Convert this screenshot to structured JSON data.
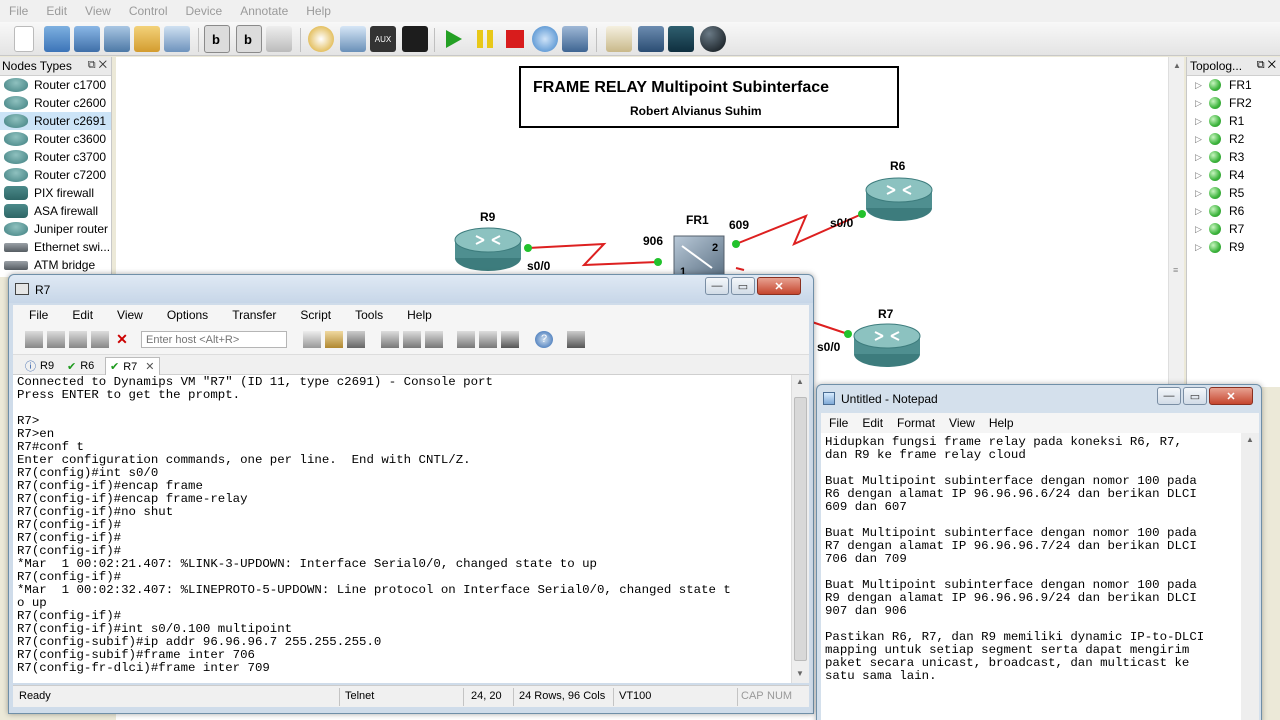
{
  "gns3": {
    "menu": [
      "File",
      "Edit",
      "View",
      "Control",
      "Device",
      "Annotate",
      "Help"
    ],
    "nodes_panel": {
      "title": "Nodes Types",
      "items": [
        {
          "label": "Router c1700",
          "icon": "router"
        },
        {
          "label": "Router c2600",
          "icon": "router"
        },
        {
          "label": "Router c2691",
          "icon": "router",
          "selected": true
        },
        {
          "label": "Router c3600",
          "icon": "router"
        },
        {
          "label": "Router c3700",
          "icon": "router"
        },
        {
          "label": "Router c7200",
          "icon": "router"
        },
        {
          "label": "PIX firewall",
          "icon": "firewall"
        },
        {
          "label": "ASA firewall",
          "icon": "firewall"
        },
        {
          "label": "Juniper router",
          "icon": "router"
        },
        {
          "label": "Ethernet swi...",
          "icon": "switch"
        },
        {
          "label": "ATM bridge",
          "icon": "switch"
        }
      ]
    },
    "topology_panel": {
      "title": "Topolog...",
      "items": [
        "FR1",
        "FR2",
        "R1",
        "R2",
        "R3",
        "R4",
        "R5",
        "R6",
        "R7",
        "R9"
      ]
    },
    "canvas": {
      "title_box": {
        "title": "FRAME RELAY Multipoint Subinterface",
        "author": "Robert Alvianus Suhim"
      },
      "devices": {
        "r9": "R9",
        "fr1": "FR1",
        "r6": "R6",
        "r7": "R7"
      },
      "labels": {
        "r9_port": "s0/0",
        "fr1_port_906": "906",
        "fr1_port_609": "609",
        "fr1_p2": "2",
        "fr1_p1": "1",
        "r6_port": "s0/0",
        "r7_port": "s0/0"
      },
      "link_color": "#dd2020",
      "port_color": "#22c22c"
    }
  },
  "securecrt": {
    "title": "R7",
    "menu": [
      "File",
      "Edit",
      "View",
      "Options",
      "Transfer",
      "Script",
      "Tools",
      "Help"
    ],
    "host_placeholder": "Enter host <Alt+R>",
    "tabs": [
      {
        "label": "R9",
        "status": "info-icon"
      },
      {
        "label": "R6",
        "status": "check-icon"
      },
      {
        "label": "R7",
        "status": "check-icon",
        "active": true
      }
    ],
    "terminal_lines": [
      "Connected to Dynamips VM \"R7\" (ID 11, type c2691) - Console port",
      "Press ENTER to get the prompt.",
      "",
      "R7>",
      "R7>en",
      "R7#conf t",
      "Enter configuration commands, one per line.  End with CNTL/Z.",
      "R7(config)#int s0/0",
      "R7(config-if)#encap frame",
      "R7(config-if)#encap frame-relay",
      "R7(config-if)#no shut",
      "R7(config-if)#",
      "R7(config-if)#",
      "R7(config-if)#",
      "*Mar  1 00:02:21.407: %LINK-3-UPDOWN: Interface Serial0/0, changed state to up",
      "R7(config-if)#",
      "*Mar  1 00:02:32.407: %LINEPROTO-5-UPDOWN: Line protocol on Interface Serial0/0, changed state t",
      "o up",
      "R7(config-if)#",
      "R7(config-if)#int s0/0.100 multipoint",
      "R7(config-subif)#ip addr 96.96.96.7 255.255.255.0",
      "R7(config-subif)#frame inter 706",
      "R7(config-fr-dlci)#frame inter 709"
    ],
    "status": {
      "state": "Ready",
      "protocol": "Telnet",
      "cursor": "24, 20",
      "size": "24 Rows, 96 Cols",
      "term": "VT100",
      "caps": "CAP",
      "num": "NUM"
    }
  },
  "notepad": {
    "title": "Untitled - Notepad",
    "menu": [
      "File",
      "Edit",
      "Format",
      "View",
      "Help"
    ],
    "text": "Hidupkan fungsi frame relay pada koneksi R6, R7,\ndan R9 ke frame relay cloud\n\nBuat Multipoint subinterface dengan nomor 100 pada\nR6 dengan alamat IP 96.96.96.6/24 dan berikan DLCI\n609 dan 607\n\nBuat Multipoint subinterface dengan nomor 100 pada\nR7 dengan alamat IP 96.96.96.7/24 dan berikan DLCI\n706 dan 709\n\nBuat Multipoint subinterface dengan nomor 100 pada\nR9 dengan alamat IP 96.96.96.9/24 dan berikan DLCI\n907 dan 906\n\nPastikan R6, R7, dan R9 memiliki dynamic IP-to-DLCI\nmapping untuk setiap segment serta dapat mengirim\npaket secara unicast, broadcast, dan multicast ke\nsatu sama lain."
  }
}
